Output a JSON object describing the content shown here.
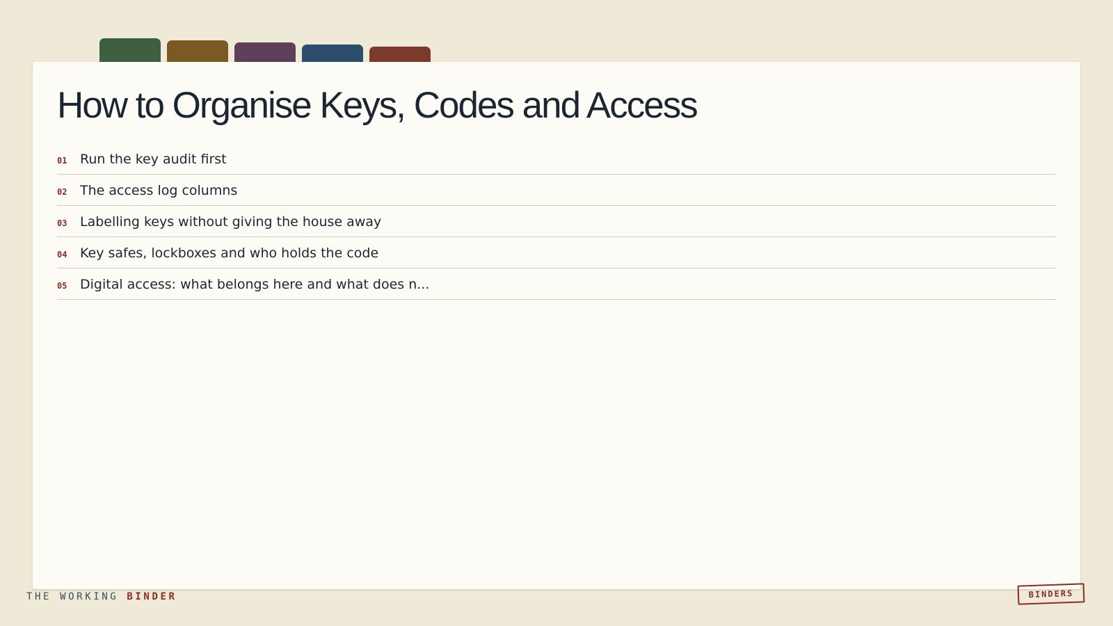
{
  "tabs": [
    {
      "color": "#3e6040"
    },
    {
      "color": "#7a5a22"
    },
    {
      "color": "#5e3e58"
    },
    {
      "color": "#2c4e6c"
    },
    {
      "color": "#7c3a2a"
    }
  ],
  "title": "How to Organise Keys, Codes and Access",
  "toc": [
    {
      "num": "01",
      "label": "Run the key audit first"
    },
    {
      "num": "02",
      "label": "The access log columns"
    },
    {
      "num": "03",
      "label": "Labelling keys without giving the house away"
    },
    {
      "num": "04",
      "label": "Key safes, lockboxes and who holds the code"
    },
    {
      "num": "05",
      "label": "Digital access: what belongs here and what does n..."
    }
  ],
  "footer": {
    "brand_prefix": "THE WORKING ",
    "brand_accent": "BINDER",
    "stamp": "BINDERS"
  },
  "colors": {
    "background": "#efe9d8",
    "card": "#fdfbf6",
    "accent": "#8a2c24",
    "text": "#1c2630"
  }
}
